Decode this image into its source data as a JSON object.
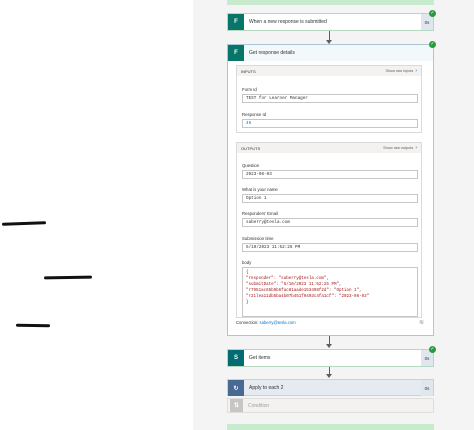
{
  "steps": {
    "trigger": {
      "title": "When a new response is submitted",
      "time": "0s"
    },
    "get_response": {
      "title": "Get response details",
      "time": "0s"
    },
    "get_items": {
      "title": "Get items",
      "time": "0s"
    },
    "apply_each": {
      "title": "Apply to each 2",
      "time": "0s"
    },
    "condition": {
      "title": "Condition"
    }
  },
  "inputs": {
    "header": "INPUTS",
    "show_raw": "Show raw inputs",
    "form_id_label": "Form Id",
    "form_id_value": "TEST for Learner Manager",
    "response_id_label": "Response Id",
    "response_id_value": "46"
  },
  "outputs": {
    "header": "OUTPUTS",
    "show_raw": "Show raw outputs",
    "question_label": "Question",
    "question_value": "2023-06-03",
    "what_label": "What is your name",
    "what_value": "Option 1",
    "respondent_label": "Responders' Email",
    "respondent_value": "saberry@tesla.com",
    "submission_label": "Submission time",
    "submission_value": "5/10/2023 11:52:25 PM",
    "body_label": "body",
    "body_lines": [
      "{",
      "  \"responder\": \"saberry@tesla.com\",",
      "  \"submitDate\": \"5/10/2023 11:52:25 PM\",",
      "  \"r7951ac65b9b6fac81aade153498f2d\": \"Option 1\",",
      "  \"r21lea11db5ba4b07b451f9403c4fa1cf\": \"2023-06-03\"",
      "}"
    ]
  },
  "connection": {
    "label": "Connection:",
    "value": "saberry@tesla.com"
  },
  "colors": {
    "forms": "#077568",
    "sharepoint": "#036c70",
    "loop": "#486991",
    "success": "#2b9a3f"
  }
}
